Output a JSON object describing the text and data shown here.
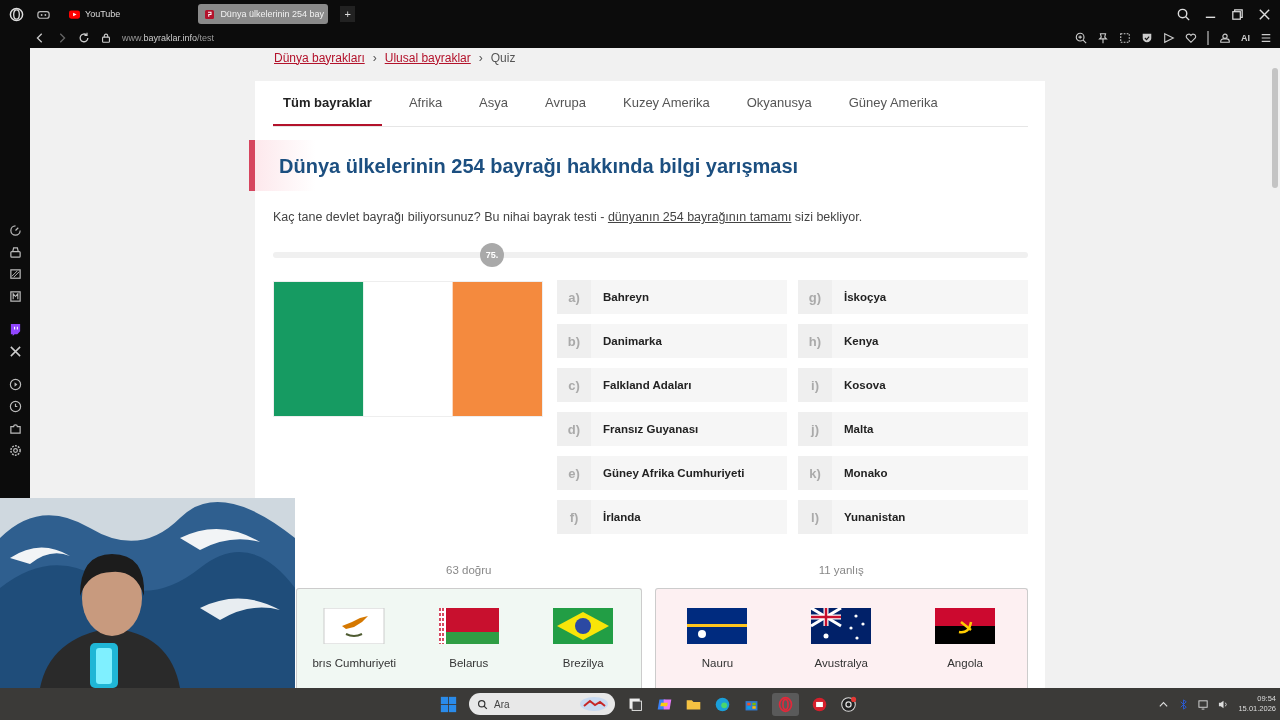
{
  "browser": {
    "tabs": [
      {
        "label": "YouTube",
        "kind": "youtube",
        "selected": false
      },
      {
        "label": "Dünya ülkelerinin 254 bay",
        "kind": "site",
        "selected": true
      }
    ],
    "new_tab": "+",
    "address": "www.**bayraklar.info**/test",
    "ai_label": "AI"
  },
  "page": {
    "breadcrumb": [
      {
        "label": "Dünya bayrakları",
        "link": true
      },
      {
        "label": "Ulusal bayraklar",
        "link": true
      },
      {
        "label": "Quiz",
        "link": false
      }
    ],
    "breadcrumb_separator": "›",
    "categories": [
      {
        "label": "Tüm bayraklar",
        "selected": true
      },
      {
        "label": "Afrika",
        "selected": false
      },
      {
        "label": "Asya",
        "selected": false
      },
      {
        "label": "Avrupa",
        "selected": false
      },
      {
        "label": "Kuzey Amerika",
        "selected": false
      },
      {
        "label": "Okyanusya",
        "selected": false
      },
      {
        "label": "Güney Amerika",
        "selected": false
      }
    ],
    "title": "Dünya ülkelerinin 254 bayrağı hakkında bilgi yarışması",
    "intro": {
      "before": "Kaç tane devlet bayrağı biliyorsunuz? Bu nihai bayrak testi - ",
      "link": "dünyanın 254 bayrağının tamamı",
      "after": " sizi bekliyor."
    },
    "progress": {
      "level": 0.29,
      "label": "75."
    },
    "question": {
      "kind": "ireland"
    },
    "options": [
      {
        "letter": "a)",
        "name": "Bahreyn"
      },
      {
        "letter": "b)",
        "name": "Danimarka"
      },
      {
        "letter": "c)",
        "name": "Falkland Adaları"
      },
      {
        "letter": "d)",
        "name": "Fransız Guyanası"
      },
      {
        "letter": "e)",
        "name": "Güney Afrika Cumhuriyeti"
      },
      {
        "letter": "f)",
        "name": "İrlanda"
      },
      {
        "letter": "g)",
        "name": "İskoçya"
      },
      {
        "letter": "h)",
        "name": "Kenya"
      },
      {
        "letter": "i)",
        "name": "Kosova"
      },
      {
        "letter": "j)",
        "name": "Malta"
      },
      {
        "letter": "k)",
        "name": "Monako"
      },
      {
        "letter": "l)",
        "name": "Yunanistan"
      }
    ],
    "results": [
      {
        "kind": "correct",
        "label": "63 doğru",
        "items": [
          {
            "name": "brıs Cumhuriyeti",
            "kind": "cyprus"
          },
          {
            "name": "Belarus",
            "kind": "belarus"
          },
          {
            "name": "Brezilya",
            "kind": "brazil"
          }
        ]
      },
      {
        "kind": "wrong",
        "label": "11 yanlış",
        "items": [
          {
            "name": "Nauru",
            "kind": "nauru"
          },
          {
            "name": "Avustralya",
            "kind": "australia"
          },
          {
            "name": "Angola",
            "kind": "angola"
          }
        ]
      }
    ]
  },
  "taskbar": {
    "search_placeholder": "Ara",
    "time": "09:54",
    "date": "15.01.2026"
  }
}
